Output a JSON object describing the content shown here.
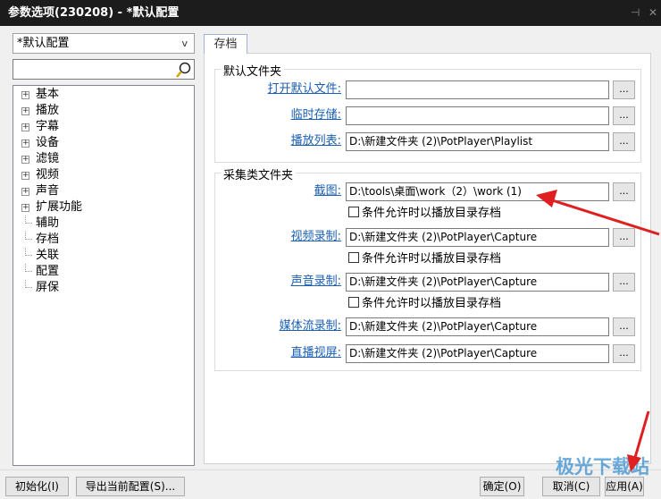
{
  "window": {
    "title": "参数选项(230208) - *默认配置",
    "pin_icon": "pin-icon",
    "close_icon": "close-icon",
    "pin": "⊣",
    "close": "✕"
  },
  "sidebar": {
    "preset": "*默认配置",
    "preset_chevron": "v",
    "search_value": "",
    "tree": [
      {
        "label": "基本",
        "expandable": true
      },
      {
        "label": "播放",
        "expandable": true
      },
      {
        "label": "字幕",
        "expandable": true
      },
      {
        "label": "设备",
        "expandable": true
      },
      {
        "label": "滤镜",
        "expandable": true
      },
      {
        "label": "视频",
        "expandable": true
      },
      {
        "label": "声音",
        "expandable": true
      },
      {
        "label": "扩展功能",
        "expandable": true
      },
      {
        "label": "辅助",
        "expandable": false
      },
      {
        "label": "存档",
        "expandable": false
      },
      {
        "label": "关联",
        "expandable": false
      },
      {
        "label": "配置",
        "expandable": false
      },
      {
        "label": "屏保",
        "expandable": false
      }
    ]
  },
  "tab": "存档",
  "default_folders": {
    "title": "默认文件夹",
    "rows": [
      {
        "label": "打开默认文件:",
        "value": ""
      },
      {
        "label": "临时存储:",
        "value": ""
      },
      {
        "label": "播放列表:",
        "value": "D:\\新建文件夹 (2)\\PotPlayer\\Playlist"
      }
    ]
  },
  "capture_folders": {
    "title": "采集类文件夹",
    "rows": [
      {
        "label": "截图:",
        "value": "D:\\tools\\桌面\\work（2）\\work (1)",
        "checkbox": "条件允许时以播放目录存档",
        "checked": false
      },
      {
        "label": "视频录制:",
        "value": "D:\\新建文件夹 (2)\\PotPlayer\\Capture",
        "checkbox": "条件允许时以播放目录存档",
        "checked": false
      },
      {
        "label": "声音录制:",
        "value": "D:\\新建文件夹 (2)\\PotPlayer\\Capture",
        "checkbox": "条件允许时以播放目录存档",
        "checked": false
      },
      {
        "label": "媒体流录制:",
        "value": "D:\\新建文件夹 (2)\\PotPlayer\\Capture"
      },
      {
        "label": "直播视屏:",
        "value": "D:\\新建文件夹 (2)\\PotPlayer\\Capture"
      }
    ]
  },
  "browse_label": "...",
  "footer": {
    "reset": "初始化(I)",
    "export": "导出当前配置(S)...",
    "ok": "确定(O)",
    "cancel": "取消(C)",
    "apply": "应用(A)"
  },
  "watermark": "极光下载站",
  "annotation_color": "#e02020"
}
